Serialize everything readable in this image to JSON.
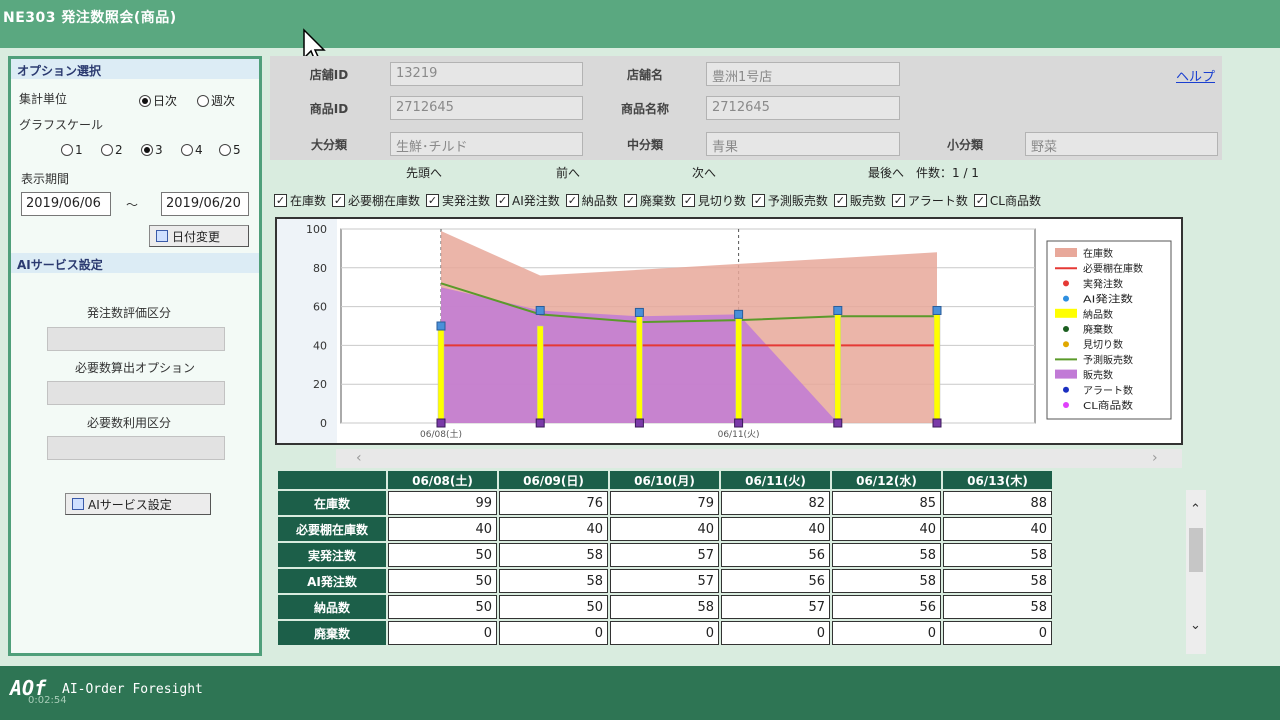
{
  "window": {
    "title": "NE303 発注数照会(商品)"
  },
  "options": {
    "header": "オプション選択",
    "agg_label": "集計単位",
    "agg_options": [
      "日次",
      "週次"
    ],
    "agg_selected": "日次",
    "scale_label": "グラフスケール",
    "scale_options": [
      "1",
      "2",
      "3",
      "4",
      "5"
    ],
    "scale_selected": "3",
    "period_label": "表示期間",
    "date_from": "2019/06/06",
    "date_sep": "～",
    "date_to": "2019/06/20",
    "date_change_button": "日付変更"
  },
  "ai": {
    "header": "AIサービス設定",
    "eval_label": "発注数評価区分",
    "calc_label": "必要数算出オプション",
    "use_label": "必要数利用区分",
    "settings_button": "AIサービス設定"
  },
  "info": {
    "store_id_label": "店舗ID",
    "store_id": "13219",
    "store_name_label": "店舗名",
    "store_name": "豊洲1号店",
    "help": "ヘルプ",
    "product_id_label": "商品ID",
    "product_id": "2712645",
    "product_name_label": "商品名称",
    "product_name": "2712645",
    "large_cat_label": "大分類",
    "large_cat": "生鮮･チルド",
    "mid_cat_label": "中分類",
    "mid_cat": "青果",
    "small_cat_label": "小分類",
    "small_cat": "野菜"
  },
  "nav": {
    "first": "先頭へ",
    "prev": "前へ",
    "next": "次へ",
    "last": "最後へ",
    "count": "件数：1 / 1"
  },
  "checkboxes": [
    "在庫数",
    "必要棚在庫数",
    "実発注数",
    "AI発注数",
    "納品数",
    "廃棄数",
    "見切り数",
    "予測販売数",
    "販売数",
    "アラート数",
    "CL商品数"
  ],
  "chart_data": {
    "type": "area",
    "categories": [
      "06/08(土)",
      "06/09(日)",
      "06/10(月)",
      "06/11(火)",
      "06/12(水)",
      "06/13(木)"
    ],
    "x_tick_labels": [
      "06/08(土)",
      "06/11(火)"
    ],
    "ylim": [
      0,
      100
    ],
    "yticks": [
      0,
      20,
      40,
      60,
      80,
      100
    ],
    "grid": true,
    "legend_position": "right",
    "series": [
      {
        "name": "在庫数",
        "type": "area",
        "color": "#e8a89a",
        "values": [
          99,
          76,
          79,
          82,
          85,
          88
        ]
      },
      {
        "name": "必要棚在庫数",
        "type": "line",
        "color": "#e53935",
        "values": [
          40,
          40,
          40,
          40,
          40,
          40
        ]
      },
      {
        "name": "実発注数",
        "type": "marker",
        "color": "#e53935",
        "values": [
          50,
          58,
          57,
          56,
          58,
          58
        ]
      },
      {
        "name": "AI発注数",
        "type": "marker",
        "color": "#2e8fe0",
        "values": [
          50,
          58,
          57,
          56,
          58,
          58
        ]
      },
      {
        "name": "納品数",
        "type": "bar",
        "color": "#ffff00",
        "values": [
          50,
          50,
          58,
          57,
          56,
          58
        ]
      },
      {
        "name": "廃棄数",
        "type": "marker",
        "color": "#1b5e20",
        "values": [
          0,
          0,
          0,
          0,
          0,
          0
        ]
      },
      {
        "name": "見切り数",
        "type": "marker",
        "color": "#e0a800",
        "values": []
      },
      {
        "name": "予測販売数",
        "type": "line",
        "color": "#5b9a2a",
        "values": [
          72,
          56,
          52,
          53,
          55,
          55
        ]
      },
      {
        "name": "販売数",
        "type": "area",
        "color": "#c17ad6",
        "values": [
          70,
          58,
          55,
          56,
          0,
          0
        ]
      },
      {
        "name": "アラート数",
        "type": "marker",
        "color": "#1a2fc0",
        "values": [
          0,
          0,
          0,
          0,
          0,
          0
        ]
      },
      {
        "name": "CL商品数",
        "type": "marker",
        "color": "#e040fb",
        "values": []
      }
    ]
  },
  "table": {
    "columns": [
      "06/08(土)",
      "06/09(日)",
      "06/10(月)",
      "06/11(火)",
      "06/12(水)",
      "06/13(木)"
    ],
    "rows": [
      {
        "label": "在庫数",
        "values": [
          "99",
          "76",
          "79",
          "82",
          "85",
          "88"
        ]
      },
      {
        "label": "必要棚在庫数",
        "values": [
          "40",
          "40",
          "40",
          "40",
          "40",
          "40"
        ]
      },
      {
        "label": "実発注数",
        "values": [
          "50",
          "58",
          "57",
          "56",
          "58",
          "58"
        ]
      },
      {
        "label": "AI発注数",
        "values": [
          "50",
          "58",
          "57",
          "56",
          "58",
          "58"
        ]
      },
      {
        "label": "納品数",
        "values": [
          "50",
          "50",
          "58",
          "57",
          "56",
          "58"
        ]
      },
      {
        "label": "廃棄数",
        "values": [
          "0",
          "0",
          "0",
          "0",
          "0",
          "0"
        ]
      }
    ]
  },
  "footer": {
    "logo": "AOf",
    "brand": "AI-Order Foresight",
    "timecode": "0:02:54"
  }
}
